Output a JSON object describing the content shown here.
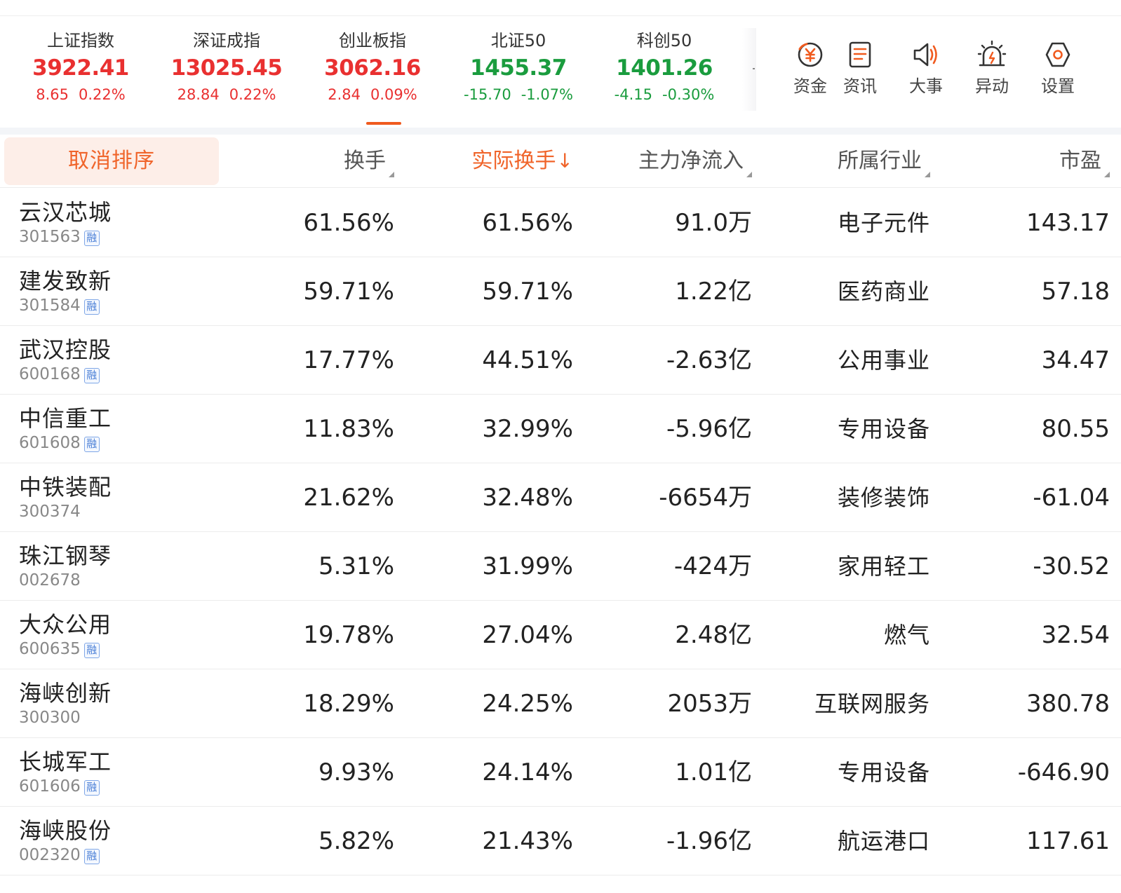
{
  "indices": [
    {
      "name": "上证指数",
      "value": "3922.41",
      "change": "8.65",
      "pct": "0.22%",
      "trend": "up"
    },
    {
      "name": "深证成指",
      "value": "13025.45",
      "change": "28.84",
      "pct": "0.22%",
      "trend": "up"
    },
    {
      "name": "创业板指",
      "value": "3062.16",
      "change": "2.84",
      "pct": "0.09%",
      "trend": "up"
    },
    {
      "name": "北证50",
      "value": "1455.37",
      "change": "-15.70",
      "pct": "-1.07%",
      "trend": "down"
    },
    {
      "name": "科创50",
      "value": "1401.26",
      "change": "-4.15",
      "pct": "-0.30%",
      "trend": "down"
    }
  ],
  "tools": [
    {
      "label": "资金",
      "icon": "fund-icon"
    },
    {
      "label": "资讯",
      "icon": "news-icon"
    },
    {
      "label": "大事",
      "icon": "megaphone-icon"
    },
    {
      "label": "异动",
      "icon": "alarm-icon"
    },
    {
      "label": "设置",
      "icon": "settings-icon"
    }
  ],
  "header": {
    "cancel_sort": "取消排序",
    "turnover": "换手",
    "actual_turnover": "实际换手",
    "actual_turnover_arrow": "↓",
    "main_net_inflow": "主力净流入",
    "industry": "所属行业",
    "pe": "市盈"
  },
  "rows": [
    {
      "name": "云汉芯城",
      "code": "301563",
      "margin": true,
      "turnover": "61.56%",
      "actual": "61.56%",
      "inflow": "91.0万",
      "inflow_trend": "up",
      "industry": "电子元件",
      "pe": "143.17"
    },
    {
      "name": "建发致新",
      "code": "301584",
      "margin": true,
      "turnover": "59.71%",
      "actual": "59.71%",
      "inflow": "1.22亿",
      "inflow_trend": "up",
      "industry": "医药商业",
      "pe": "57.18"
    },
    {
      "name": "武汉控股",
      "code": "600168",
      "margin": true,
      "turnover": "17.77%",
      "actual": "44.51%",
      "inflow": "-2.63亿",
      "inflow_trend": "down",
      "industry": "公用事业",
      "pe": "34.47"
    },
    {
      "name": "中信重工",
      "code": "601608",
      "margin": true,
      "turnover": "11.83%",
      "actual": "32.99%",
      "inflow": "-5.96亿",
      "inflow_trend": "down",
      "industry": "专用设备",
      "pe": "80.55"
    },
    {
      "name": "中铁装配",
      "code": "300374",
      "margin": false,
      "turnover": "21.62%",
      "actual": "32.48%",
      "inflow": "-6654万",
      "inflow_trend": "down",
      "industry": "装修装饰",
      "pe": "-61.04"
    },
    {
      "name": "珠江钢琴",
      "code": "002678",
      "margin": false,
      "turnover": "5.31%",
      "actual": "31.99%",
      "inflow": "-424万",
      "inflow_trend": "down",
      "industry": "家用轻工",
      "pe": "-30.52"
    },
    {
      "name": "大众公用",
      "code": "600635",
      "margin": true,
      "turnover": "19.78%",
      "actual": "27.04%",
      "inflow": "2.48亿",
      "inflow_trend": "up",
      "industry": "燃气",
      "pe": "32.54"
    },
    {
      "name": "海峡创新",
      "code": "300300",
      "margin": false,
      "turnover": "18.29%",
      "actual": "24.25%",
      "inflow": "2053万",
      "inflow_trend": "up",
      "industry": "互联网服务",
      "pe": "380.78"
    },
    {
      "name": "长城军工",
      "code": "601606",
      "margin": true,
      "turnover": "9.93%",
      "actual": "24.14%",
      "inflow": "1.01亿",
      "inflow_trend": "up",
      "industry": "专用设备",
      "pe": "-646.90"
    },
    {
      "name": "海峡股份",
      "code": "002320",
      "margin": true,
      "turnover": "5.82%",
      "actual": "21.43%",
      "inflow": "-1.96亿",
      "inflow_trend": "down",
      "industry": "航运港口",
      "pe": "117.61"
    }
  ],
  "margin_badge": "融",
  "colors": {
    "up": "#e93030",
    "down": "#1a9c3e",
    "accent": "#f05a1e"
  }
}
